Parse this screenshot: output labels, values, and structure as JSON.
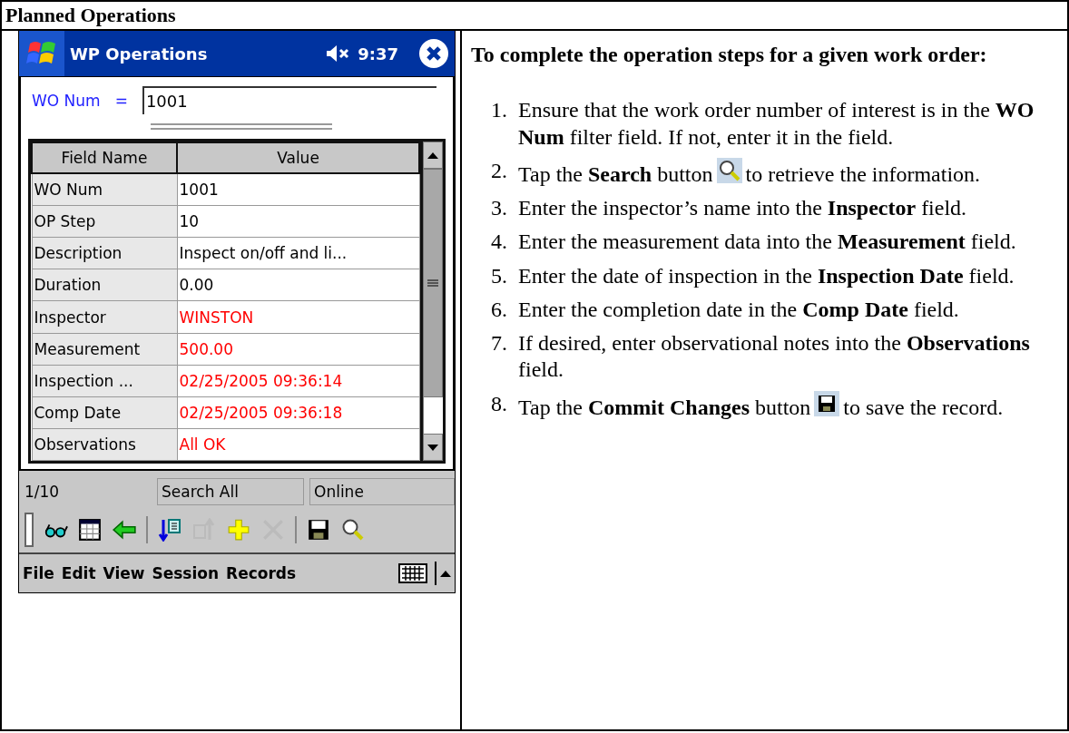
{
  "heading": "Planned Operations",
  "device": {
    "title": "WP Operations",
    "clock": "9:37",
    "filter": {
      "label": "WO Num",
      "operator": "=",
      "value": "1001"
    },
    "grid": {
      "columns": [
        "Field Name",
        "Value"
      ],
      "rows": [
        {
          "field": "WO Num",
          "value": "1001",
          "changed": false
        },
        {
          "field": "OP Step",
          "value": "10",
          "changed": false
        },
        {
          "field": "Description",
          "value": "Inspect on/off and li...",
          "changed": false
        },
        {
          "field": "Duration",
          "value": "0.00",
          "changed": false
        },
        {
          "field": "Inspector",
          "value": "WINSTON",
          "changed": true
        },
        {
          "field": "Measurement",
          "value": "500.00",
          "changed": true
        },
        {
          "field": "Inspection ...",
          "value": "02/25/2005 09:36:14",
          "changed": true
        },
        {
          "field": "Comp Date",
          "value": "02/25/2005 09:36:18",
          "changed": true
        },
        {
          "field": "Observations",
          "value": "All OK",
          "changed": true
        }
      ]
    },
    "status": {
      "record": "1/10",
      "mode": "Search All",
      "connection": "Online"
    },
    "toolbar": [
      [
        {
          "kind": "glasses",
          "disabled": false
        },
        {
          "kind": "grid",
          "disabled": false
        },
        {
          "kind": "back",
          "disabled": false
        }
      ],
      [
        {
          "kind": "import",
          "disabled": false
        },
        {
          "kind": "export",
          "disabled": true
        },
        {
          "kind": "add",
          "disabled": false
        },
        {
          "kind": "delete",
          "disabled": true
        }
      ],
      [
        {
          "kind": "save",
          "disabled": false
        },
        {
          "kind": "search",
          "disabled": false
        }
      ]
    ],
    "menu": [
      "File",
      "Edit",
      "View",
      "Session",
      "Records"
    ]
  },
  "instructions": {
    "intro": "To complete the operation steps for a given work order:",
    "steps": [
      {
        "number": "1.",
        "kind": "text",
        "text": "Ensure that the work order number of interest is in the **WO Num** filter field.  If not, enter it in the field."
      },
      {
        "number": "2.",
        "kind": "search",
        "text": "Tap the **Search** button",
        "after": "to retrieve the information."
      },
      {
        "number": "3.",
        "kind": "text",
        "text": "Enter the inspector’s name into the **Inspector** field."
      },
      {
        "number": "4.",
        "kind": "text",
        "text": "Enter the measurement data into the **Measurement** field."
      },
      {
        "number": "5.",
        "kind": "text",
        "text": "Enter the date of inspection in the **Inspection Date** field."
      },
      {
        "number": "6.",
        "kind": "text",
        "text": "Enter the completion date in the **Comp Date** field."
      },
      {
        "number": "7.",
        "kind": "text",
        "text": "If desired, enter observational notes into the **Observations** field."
      },
      {
        "number": "8.",
        "kind": "save",
        "text": "Tap the **Commit Changes** button",
        "after": "to save the record."
      }
    ]
  }
}
